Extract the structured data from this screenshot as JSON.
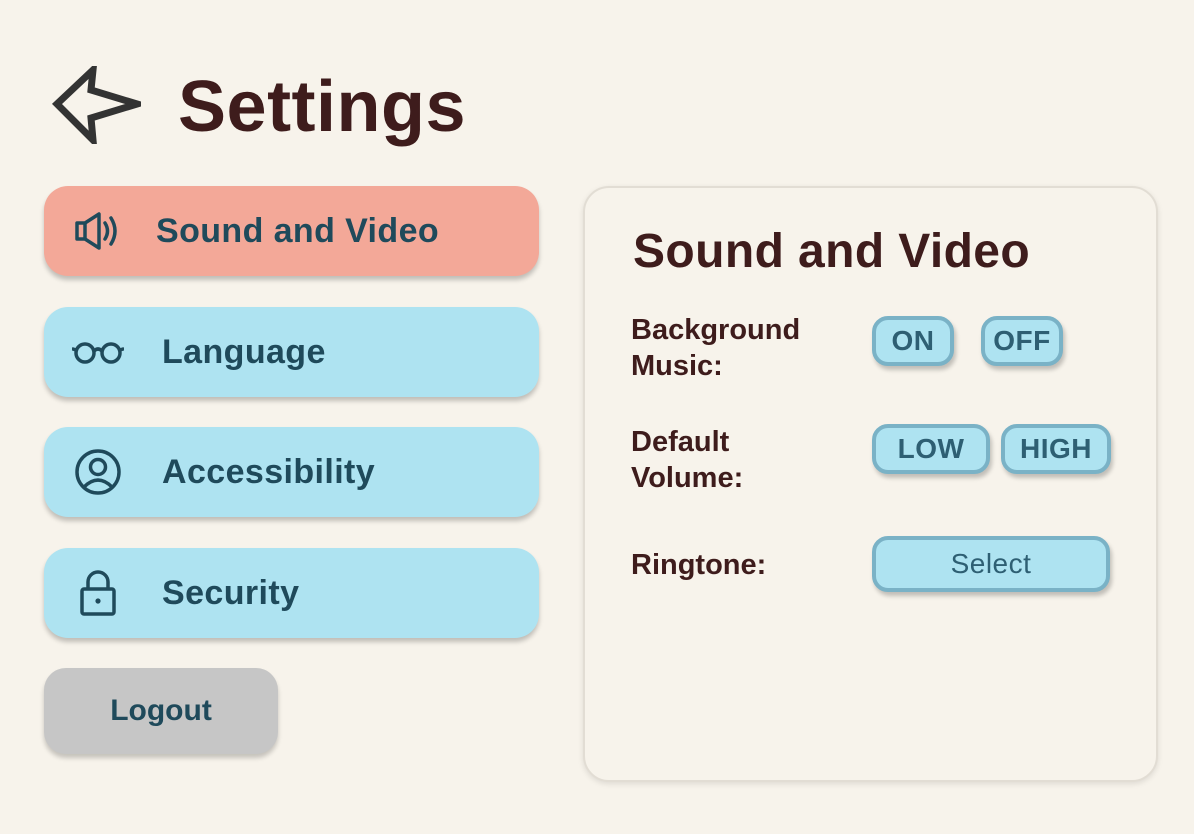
{
  "header": {
    "title": "Settings",
    "back_icon": "back-arrow-icon"
  },
  "sidebar": {
    "items": [
      {
        "label": "Sound and Video",
        "icon": "speaker-icon",
        "active": true
      },
      {
        "label": "Language",
        "icon": "glasses-icon",
        "active": false
      },
      {
        "label": "Accessibility",
        "icon": "user-circle-icon",
        "active": false
      },
      {
        "label": "Security",
        "icon": "lock-icon",
        "active": false
      }
    ],
    "logout_label": "Logout"
  },
  "panel": {
    "title": "Sound and Video",
    "background_music": {
      "label_line1": "Background",
      "label_line2": "Music:",
      "on_label": "ON",
      "off_label": "OFF"
    },
    "default_volume": {
      "label_line1": "Default",
      "label_line2": "Volume:",
      "low_label": "LOW",
      "high_label": "HIGH"
    },
    "ringtone": {
      "label": "Ringtone:",
      "select_label": "Select"
    }
  },
  "colors": {
    "background": "#f7f3eb",
    "active_item": "#f3a898",
    "idle_item": "#aee3f1",
    "logout": "#c6c6c6",
    "title_text": "#3e1c1c",
    "nav_text": "#1f4a5b",
    "pill_border": "#7ab2c6"
  }
}
